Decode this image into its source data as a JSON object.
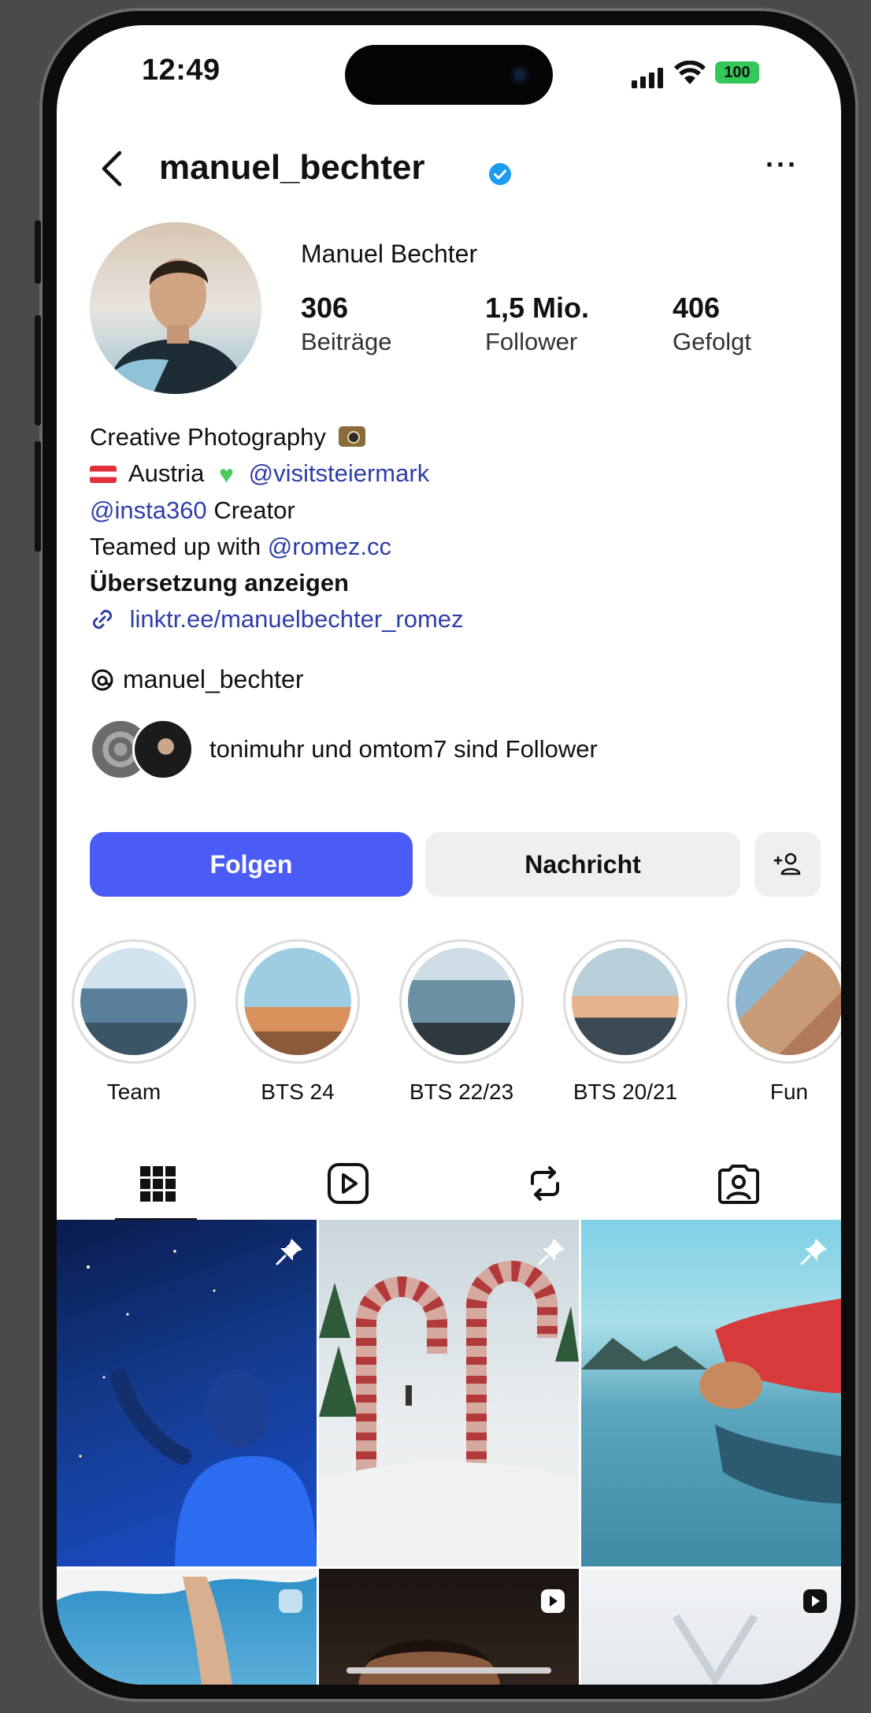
{
  "status_bar": {
    "time": "12:49",
    "battery": "100"
  },
  "header": {
    "username": "manuel_bechter",
    "more": "···"
  },
  "profile": {
    "display_name": "Manuel Bechter",
    "stats": [
      {
        "count": "306",
        "label": "Beiträge"
      },
      {
        "count": "1,5 Mio.",
        "label": "Follower"
      },
      {
        "count": "406",
        "label": "Gefolgt"
      }
    ]
  },
  "bio": {
    "line1": "Creative Photography",
    "line2_text": "Austria",
    "line2_link": "@visitsteiermark",
    "line3_link": "@insta360",
    "line3_text": "Creator",
    "line4_text": "Teamed up with",
    "line4_link": "@romez.cc",
    "translate": "Übersetzung anzeigen",
    "website": "linktr.ee/manuelbechter_romez"
  },
  "threads": {
    "handle": "manuel_bechter"
  },
  "followed_by": {
    "text": "tonimuhr und omtom7 sind Follower"
  },
  "actions": {
    "follow": "Folgen",
    "message": "Nachricht",
    "add_person": "+👤"
  },
  "highlights": [
    {
      "label": "Team",
      "color": "#5a7f9a"
    },
    {
      "label": "BTS 24",
      "color": "#d9925c"
    },
    {
      "label": "BTS 22/23",
      "color": "#6b8fa3"
    },
    {
      "label": "BTS 20/21",
      "color": "#c98a5a"
    },
    {
      "label": "Fun",
      "color": "#b07a5a"
    }
  ],
  "tabs": [
    {
      "name": "posts-grid-icon",
      "active": true
    },
    {
      "name": "reels-icon",
      "active": false
    },
    {
      "name": "reposts-icon",
      "active": false
    },
    {
      "name": "tagged-icon",
      "active": false
    }
  ],
  "colors": {
    "accent": "#4b5cf6",
    "verified": "#1d9bf0",
    "link": "#2f3ea8"
  }
}
